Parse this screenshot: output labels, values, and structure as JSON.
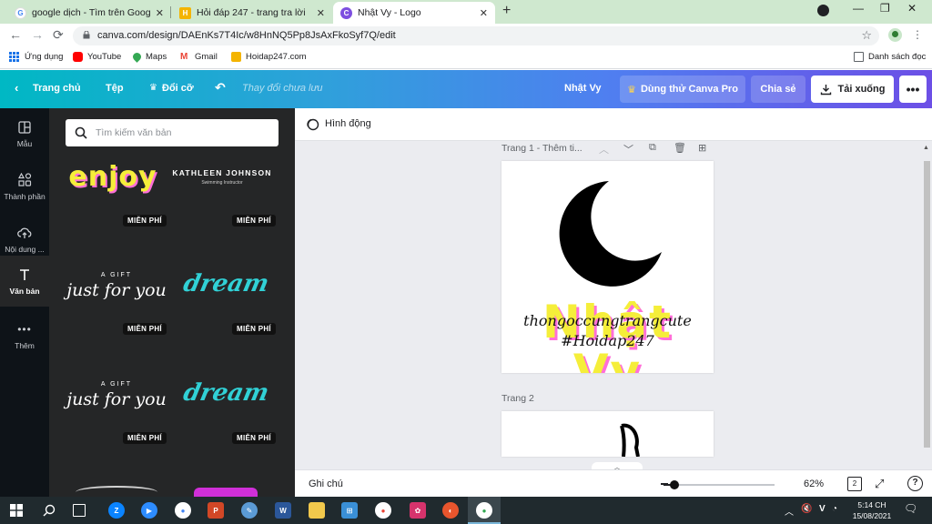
{
  "browser": {
    "tabs": [
      {
        "title": "google dịch - Tìm trên Google",
        "favicon": "google-favicon"
      },
      {
        "title": "Hỏi đáp 247 - trang tra lời",
        "favicon": "hoidap-favicon"
      },
      {
        "title": "Nhật Vy - Logo",
        "favicon": "canva-favicon",
        "active": true
      }
    ],
    "url": "canva.com/design/DAEnKs7T4Ic/w8HnNQ5Pp8JsAxFkoSyf7Q/edit",
    "bookmarks": [
      "Ứng dụng",
      "YouTube",
      "Maps",
      "Gmail",
      "Hoidap247.com"
    ],
    "reading_list": "Danh sách đọc"
  },
  "canva": {
    "home": "Trang chủ",
    "file": "Tệp",
    "resize": "Đổi cỡ",
    "unsaved": "Thay đổi chưa lưu",
    "design_name": "Nhật Vy",
    "try_pro": "Dùng thử Canva Pro",
    "share": "Chia sẻ",
    "download": "Tải xuống",
    "more": "•••"
  },
  "rail": [
    {
      "label": "Mẫu",
      "icon": "layout-icon"
    },
    {
      "label": "Thành phần",
      "icon": "shapes-icon"
    },
    {
      "label": "Nội dung ...",
      "icon": "cloud-upload-icon"
    },
    {
      "label": "Văn bản",
      "icon": "text-icon",
      "active": true
    },
    {
      "label": "Thêm",
      "icon": "more-dots-icon"
    }
  ],
  "panel": {
    "search_placeholder": "Tìm kiếm văn bản",
    "templates": [
      {
        "text": "enjoy",
        "badge": "MIỄN PHÍ"
      },
      {
        "text": "KATHLEEN JOHNSON",
        "subtext": "Swimming Instructor",
        "badge": "MIỄN PHÍ"
      },
      {
        "text": "just for you",
        "subtext": "A GIFT",
        "badge": "MIỄN PHÍ"
      },
      {
        "text": "dream",
        "badge": "MIỄN PHÍ"
      },
      {
        "text": "just for you",
        "subtext": "A GIFT",
        "badge": "MIỄN PHÍ"
      },
      {
        "text": "dream",
        "badge": "MIỄN PHÍ"
      }
    ]
  },
  "editor": {
    "animate": "Hình động",
    "page1_label": "Trang 1 - Thêm ti...",
    "page2_label": "Trang 2",
    "logo_main": "Nhật Vy",
    "logo_script1": "thongoccungtrangcute",
    "logo_script2": "#Hoidap247"
  },
  "status": {
    "notes": "Ghi chú",
    "zoom": "62%",
    "zoom_fraction": 0.1,
    "page_count": "2",
    "help": "?"
  },
  "taskbar": {
    "time": "5:14 CH",
    "date": "15/08/2021",
    "ime": "V"
  },
  "colors": {
    "canva_gradient_start": "#00b8c4",
    "canva_gradient_end": "#6c4fe6",
    "logo_yellow": "#f5ee3a",
    "logo_pink": "#ff6fd8",
    "dream_cyan": "#31d1d6"
  }
}
